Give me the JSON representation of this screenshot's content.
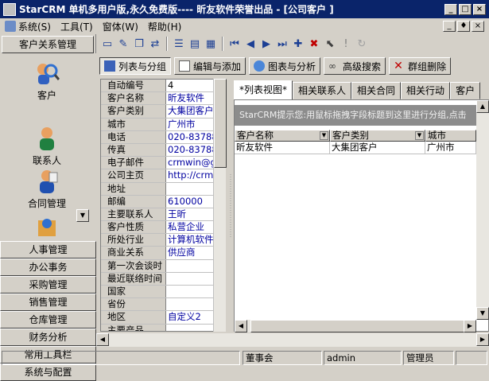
{
  "window": {
    "title": "StarCRM 单机多用户版,永久免费版---- 昕友软件荣誉出品 - [公司客户 ]",
    "buttons": [
      "_",
      "□",
      "×"
    ],
    "mdi_buttons": [
      "_",
      "♦",
      "×"
    ]
  },
  "menu": [
    {
      "label": "系统(S)"
    },
    {
      "label": "工具(T)"
    },
    {
      "label": "窗体(W)"
    },
    {
      "label": "帮助(H)"
    }
  ],
  "sidebar": {
    "header": "客户关系管理",
    "nav_items": [
      {
        "label": "客户",
        "icon": "search-person-icon"
      },
      {
        "label": "联系人",
        "icon": "contacts-icon"
      },
      {
        "label": "合同管理",
        "icon": "contract-icon"
      }
    ],
    "groups": [
      "人事管理",
      "办公事务",
      "采购管理",
      "销售管理",
      "仓库管理",
      "财务分析",
      "常用工具栏",
      "系统与配置"
    ]
  },
  "actions": {
    "list_group": "列表与分组",
    "edit_add": "编辑与添加",
    "chart_analysis": "图表与分析",
    "advanced_search": "高级搜索",
    "batch_delete": "群组删除"
  },
  "form": {
    "fields": [
      {
        "label": "自动编号",
        "value": "4",
        "black": true
      },
      {
        "label": "客户名称",
        "value": "昕友软件"
      },
      {
        "label": "客户类别",
        "value": "大集团客户"
      },
      {
        "label": "城市",
        "value": "广州市"
      },
      {
        "label": "电话",
        "value": "020-837883"
      },
      {
        "label": "传真",
        "value": "020-837883"
      },
      {
        "label": "电子邮件",
        "value": "crmwin@gma"
      },
      {
        "label": "公司主页",
        "value": "http://crm"
      },
      {
        "label": "地址",
        "value": ""
      },
      {
        "label": "邮编",
        "value": "610000"
      },
      {
        "label": "主要联系人",
        "value": "王昕"
      },
      {
        "label": "客户性质",
        "value": "私营企业"
      },
      {
        "label": "所处行业",
        "value": "计算机软件"
      },
      {
        "label": "商业关系",
        "value": "供应商"
      },
      {
        "label": "第一次会谈时",
        "value": ""
      },
      {
        "label": "最近联络时间",
        "value": ""
      },
      {
        "label": "国家",
        "value": ""
      },
      {
        "label": "省份",
        "value": ""
      },
      {
        "label": "地区",
        "value": "自定义2"
      },
      {
        "label": "主要产品",
        "value": ""
      }
    ]
  },
  "tabs": [
    "*列表视图*",
    "相关联系人",
    "相关合同",
    "相关行动",
    "客户"
  ],
  "grid": {
    "hint": "StarCRM提示您:用鼠标拖拽字段标题到这里进行分组,点击",
    "columns": [
      "客户名称",
      "客户类别",
      "城市"
    ],
    "rows": [
      [
        "昕友软件",
        "大集团客户",
        "广州市"
      ]
    ]
  },
  "status": {
    "cells": [
      "",
      "董事会",
      "admin",
      "管理员",
      ""
    ]
  },
  "colors": {
    "titlebar": "#0a246a",
    "face": "#d4d0c8",
    "value_text": "#0000a0"
  }
}
